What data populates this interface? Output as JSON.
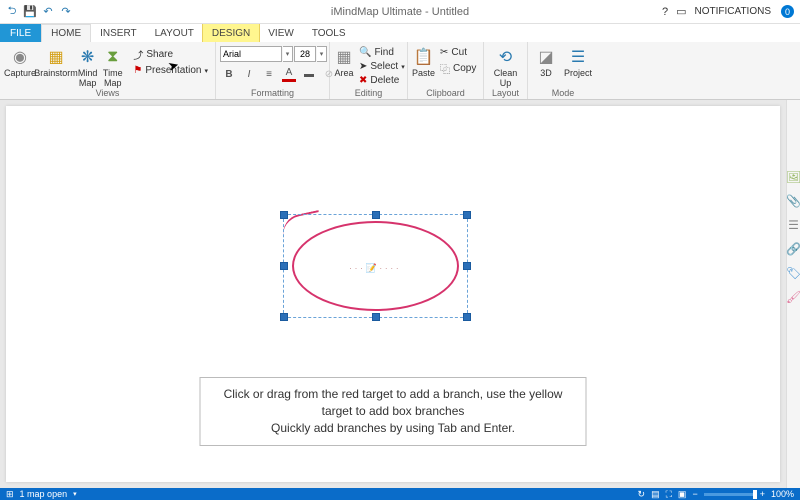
{
  "title": "iMindMap Ultimate - Untitled",
  "notifications": {
    "label": "NOTIFICATIONS",
    "count": "0"
  },
  "tabs": {
    "file": "FILE",
    "home": "HOME",
    "insert": "INSERT",
    "layout": "LAYOUT",
    "design": "DESIGN",
    "view": "VIEW",
    "tools": "TOOLS"
  },
  "ribbon": {
    "views": {
      "label": "Views",
      "capture": "Capture",
      "brainstorm": "Brainstorm",
      "mindmap": "Mind Map",
      "timemap": "Time Map",
      "presentation": "Presentation",
      "share": "Share"
    },
    "formatting": {
      "label": "Formatting",
      "font": "Arial",
      "size": "28"
    },
    "editing": {
      "label": "Editing",
      "area": "Area",
      "find": "Find",
      "select": "Select",
      "delete": "Delete"
    },
    "clipboard": {
      "label": "Clipboard",
      "paste": "Paste",
      "cut": "Cut",
      "copy": "Copy"
    },
    "layout": {
      "label": "Layout",
      "cleanup": "Clean Up"
    },
    "mode": {
      "label": "Mode",
      "d3": "3D",
      "project": "Project"
    }
  },
  "hint": {
    "l1": "Click or drag from the red target to add a branch, use the yellow target to add box branches",
    "l2": "Quickly add branches by using Tab and Enter."
  },
  "status": {
    "maps": "1 map open",
    "zoom": "100%"
  },
  "canvas": {
    "node_placeholder": "· · ·  📝 · · · ·"
  }
}
